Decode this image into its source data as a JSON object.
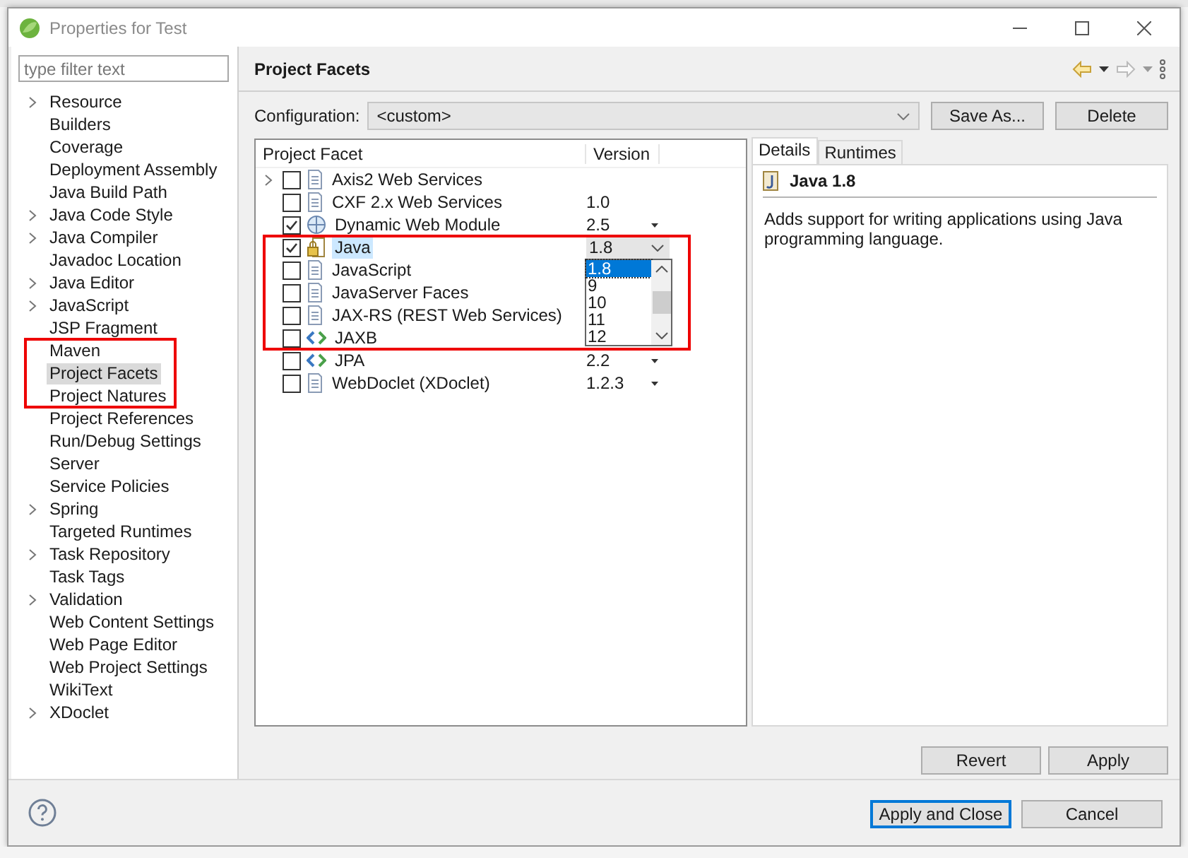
{
  "window": {
    "title": "Properties for Test"
  },
  "filter": {
    "placeholder": "type filter text"
  },
  "tree": [
    {
      "label": "Resource",
      "expandable": true,
      "selected": false
    },
    {
      "label": "Builders",
      "expandable": false,
      "selected": false
    },
    {
      "label": "Coverage",
      "expandable": false,
      "selected": false
    },
    {
      "label": "Deployment Assembly",
      "expandable": false,
      "selected": false
    },
    {
      "label": "Java Build Path",
      "expandable": false,
      "selected": false
    },
    {
      "label": "Java Code Style",
      "expandable": true,
      "selected": false
    },
    {
      "label": "Java Compiler",
      "expandable": true,
      "selected": false
    },
    {
      "label": "Javadoc Location",
      "expandable": false,
      "selected": false
    },
    {
      "label": "Java Editor",
      "expandable": true,
      "selected": false
    },
    {
      "label": "JavaScript",
      "expandable": true,
      "selected": false
    },
    {
      "label": "JSP Fragment",
      "expandable": false,
      "selected": false
    },
    {
      "label": "Maven",
      "expandable": false,
      "selected": false
    },
    {
      "label": "Project Facets",
      "expandable": false,
      "selected": true
    },
    {
      "label": "Project Natures",
      "expandable": false,
      "selected": false
    },
    {
      "label": "Project References",
      "expandable": false,
      "selected": false
    },
    {
      "label": "Run/Debug Settings",
      "expandable": false,
      "selected": false
    },
    {
      "label": "Server",
      "expandable": false,
      "selected": false
    },
    {
      "label": "Service Policies",
      "expandable": false,
      "selected": false
    },
    {
      "label": "Spring",
      "expandable": true,
      "selected": false
    },
    {
      "label": "Targeted Runtimes",
      "expandable": false,
      "selected": false
    },
    {
      "label": "Task Repository",
      "expandable": true,
      "selected": false
    },
    {
      "label": "Task Tags",
      "expandable": false,
      "selected": false
    },
    {
      "label": "Validation",
      "expandable": true,
      "selected": false
    },
    {
      "label": "Web Content Settings",
      "expandable": false,
      "selected": false
    },
    {
      "label": "Web Page Editor",
      "expandable": false,
      "selected": false
    },
    {
      "label": "Web Project Settings",
      "expandable": false,
      "selected": false
    },
    {
      "label": "WikiText",
      "expandable": false,
      "selected": false
    },
    {
      "label": "XDoclet",
      "expandable": true,
      "selected": false
    }
  ],
  "page": {
    "title": "Project Facets",
    "configuration_label": "Configuration:",
    "configuration_value": "<custom>",
    "save_as": "Save As...",
    "delete": "Delete"
  },
  "facets": {
    "columns": [
      "Project Facet",
      "Version"
    ],
    "rows": [
      {
        "label": "Axis2 Web Services",
        "kind": "document",
        "expandable": true,
        "checked": false,
        "selected": false,
        "dropdown": false
      },
      {
        "label": "CXF 2.x Web Services",
        "kind": "document",
        "expandable": false,
        "checked": false,
        "selected": false,
        "version": "1.0",
        "dropdown": false
      },
      {
        "label": "Dynamic Web Module",
        "kind": "web",
        "expandable": false,
        "checked": true,
        "selected": false,
        "version": "2.5",
        "dropdown": true,
        "open": false
      },
      {
        "label": "Java",
        "kind": "java",
        "expandable": false,
        "checked": true,
        "selected": true,
        "version": "1.8",
        "dropdown": true,
        "open": true
      },
      {
        "label": "JavaScript",
        "kind": "document",
        "expandable": false,
        "checked": false,
        "selected": false,
        "dropdown": false
      },
      {
        "label": "JavaServer Faces",
        "kind": "document",
        "expandable": false,
        "checked": false,
        "selected": false,
        "dropdown": false
      },
      {
        "label": "JAX-RS (REST Web Services)",
        "kind": "document",
        "expandable": false,
        "checked": false,
        "selected": false,
        "dropdown": false
      },
      {
        "label": "JAXB",
        "kind": "binding",
        "expandable": false,
        "checked": false,
        "selected": false,
        "dropdown": false
      },
      {
        "label": "JPA",
        "kind": "binding",
        "expandable": false,
        "checked": false,
        "selected": false,
        "version": "2.2",
        "dropdown": true,
        "open": false
      },
      {
        "label": "WebDoclet (XDoclet)",
        "kind": "document",
        "expandable": false,
        "checked": false,
        "selected": false,
        "version": "1.2.3",
        "dropdown": true,
        "open": false
      }
    ]
  },
  "version_list": [
    {
      "label": "1.8",
      "selected": true
    },
    {
      "label": "9",
      "selected": false
    },
    {
      "label": "10",
      "selected": false
    },
    {
      "label": "11",
      "selected": false
    },
    {
      "label": "12",
      "selected": false
    }
  ],
  "details": {
    "tabs": [
      {
        "label": "Details",
        "selected": true
      },
      {
        "label": "Runtimes",
        "selected": false
      }
    ],
    "heading": "Java 1.8",
    "description": "Adds support for writing applications using Java programming language."
  },
  "buttons": {
    "revert": "Revert",
    "apply": "Apply",
    "apply_close": "Apply and Close",
    "cancel": "Cancel"
  }
}
